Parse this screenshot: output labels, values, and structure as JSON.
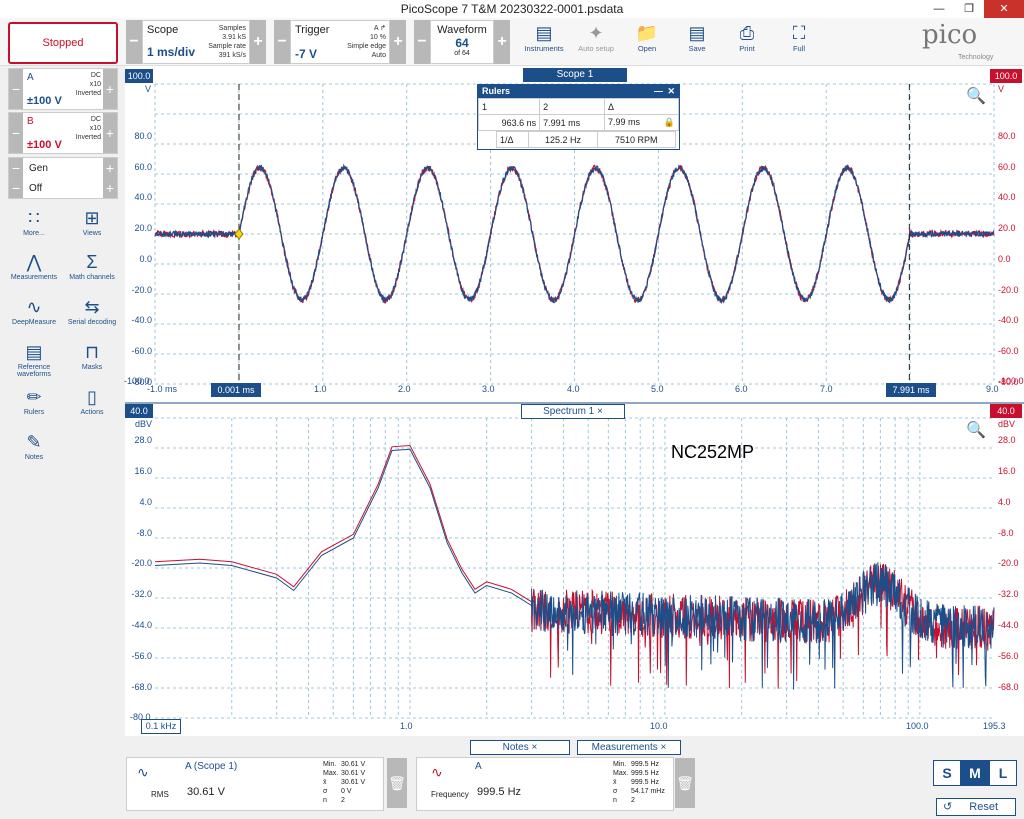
{
  "window": {
    "title": "PicoScope 7 T&M 20230322-0001.psdata"
  },
  "run": {
    "label": "Stopped"
  },
  "scope": {
    "title": "Scope",
    "timebase": "1 ms/div",
    "samples_label": "Samples",
    "samples": "3.91 kS",
    "rate_label": "Sample rate",
    "rate": "391 kS/s"
  },
  "trigger": {
    "title": "Trigger",
    "level": "-7 V",
    "channel": "A",
    "pct": "10 %",
    "type": "Simple edge",
    "mode": "Auto"
  },
  "waveform": {
    "title": "Waveform",
    "num": "64",
    "of": "of 64"
  },
  "tools": [
    {
      "label": "Instruments",
      "icon": "instruments-icon"
    },
    {
      "label": "Auto setup",
      "icon": "wand-icon"
    },
    {
      "label": "Open",
      "icon": "folder-icon"
    },
    {
      "label": "Save",
      "icon": "save-icon"
    },
    {
      "label": "Print",
      "icon": "print-icon"
    },
    {
      "label": "Full",
      "icon": "fullscreen-icon"
    }
  ],
  "logo": {
    "name": "pico",
    "sub": "Technology"
  },
  "channels": [
    {
      "name": "A",
      "range": "±100 V",
      "coupling": "DC",
      "probe": "x10",
      "mode": "Inverted",
      "color": "#1c4f8a"
    },
    {
      "name": "B",
      "range": "±100 V",
      "coupling": "DC",
      "probe": "x10",
      "mode": "Inverted",
      "color": "#c8102e"
    }
  ],
  "gen": {
    "label": "Gen",
    "state": "Off"
  },
  "sidebar_tools": [
    {
      "label": "More...",
      "icon": "grid-dots-icon"
    },
    {
      "label": "Views",
      "icon": "views-icon"
    },
    {
      "label": "Measurements",
      "icon": "measurements-icon"
    },
    {
      "label": "Math channels",
      "icon": "sigma-icon"
    },
    {
      "label": "DeepMeasure",
      "icon": "deepmeasure-icon"
    },
    {
      "label": "Serial decoding",
      "icon": "serial-icon"
    },
    {
      "label": "Reference waveforms",
      "icon": "reference-icon"
    },
    {
      "label": "Masks",
      "icon": "masks-icon"
    },
    {
      "label": "Rulers",
      "icon": "ruler-icon"
    },
    {
      "label": "Actions",
      "icon": "actions-icon"
    },
    {
      "label": "Notes",
      "icon": "notes-icon"
    }
  ],
  "scope_view": {
    "tab": "Scope 1",
    "range_left": "100.0",
    "range_right": "100.0",
    "unit_left": "V",
    "unit_right": "V",
    "y_ticks": [
      "80.0",
      "60.0",
      "40.0",
      "20.0",
      "0.0",
      "-20.0",
      "-40.0",
      "-60.0",
      "-80.0",
      "-100.0"
    ],
    "x_ticks": [
      "-1.0 ms",
      "1.0",
      "2.0",
      "3.0",
      "4.0",
      "5.0",
      "6.0",
      "7.0",
      "8.0",
      "9.0"
    ],
    "ruler1_label": "0.001 ms",
    "ruler2_label": "7.991 ms"
  },
  "rulers": {
    "title": "Rulers",
    "h1": "1",
    "h2": "2",
    "h3": "Δ",
    "v1": "963.6 ns",
    "v2": "7.991 ms",
    "v3": "7.99 ms",
    "inv": "1/Δ",
    "freq": "125.2 Hz",
    "rpm": "7510 RPM"
  },
  "spectrum_view": {
    "tab": "Spectrum 1",
    "range_left": "40.0",
    "range_right": "40.0",
    "unit": "dBV",
    "y_ticks": [
      "28.0",
      "16.0",
      "4.0",
      "-8.0",
      "-20.0",
      "-32.0",
      "-44.0",
      "-56.0",
      "-68.0"
    ],
    "y_bottom": "-80.0",
    "x_ticks": [
      "0.1 kHz",
      "1.0",
      "10.0",
      "100.0",
      "195.3"
    ],
    "annotation": "NC252MP"
  },
  "bottom_tabs": [
    "Notes",
    "Measurements"
  ],
  "measurements": [
    {
      "title": "A (Scope 1)",
      "kind": "RMS",
      "value": "30.61 V",
      "min": "30.61 V",
      "max": "30.61 V",
      "mean": "30.61 V",
      "sd": "0 V",
      "n": "2"
    },
    {
      "title": "A",
      "kind": "Frequency",
      "value": "999.5 Hz",
      "min": "999.5 Hz",
      "max": "999.5 Hz",
      "mean": "999.5 Hz",
      "sd": "54.17 mHz",
      "n": "2"
    }
  ],
  "stat_labels": {
    "min": "Min.",
    "max": "Max.",
    "mean": "x̄",
    "sd": "σ",
    "n": "n"
  },
  "size": {
    "s": "S",
    "m": "M",
    "l": "L"
  },
  "reset": {
    "label": "Reset"
  },
  "colors": {
    "accent": "#1c4f8a",
    "channel_a": "#1c4f8a",
    "channel_b": "#c8102e"
  }
}
